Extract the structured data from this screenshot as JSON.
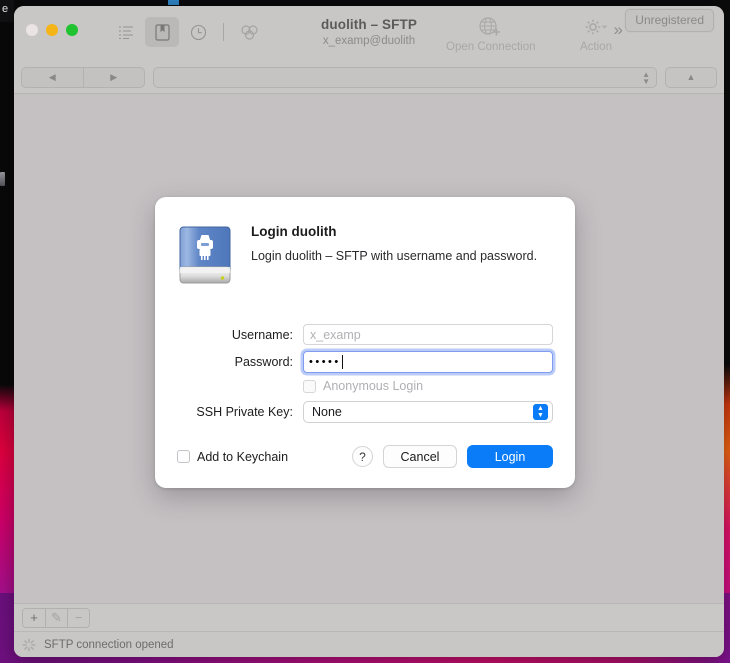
{
  "desktop": {
    "menubar_fragment": "e",
    "wallpaper_colors": [
      "#0a0a0c",
      "#c01030",
      "#ef6a14",
      "#d4106a",
      "#8f1090"
    ]
  },
  "window": {
    "title": "duolith – SFTP",
    "subtitle": "x_examp@duolith",
    "traffic_lights": [
      {
        "name": "close",
        "color": "#ebe4e4"
      },
      {
        "name": "minimize",
        "color": "#f5b518"
      },
      {
        "name": "maximize",
        "color": "#1fc22f"
      }
    ],
    "toolbar": {
      "left_icons": [
        {
          "name": "outline-list-icon",
          "label": "",
          "active": false
        },
        {
          "name": "bookmarks-icon",
          "label": "",
          "active": true
        },
        {
          "name": "history-clock-icon",
          "label": "",
          "active": false
        },
        {
          "name": "bonjour-icon",
          "label": "",
          "active": false
        }
      ],
      "open_connection_label": "Open Connection",
      "action_label": "Action",
      "overflow_glyph": "»",
      "unregistered_label": "Unregistered"
    },
    "navbar": {
      "back_glyph": "◀",
      "forward_glyph": "▶",
      "path_value": "",
      "path_placeholder": "",
      "parent_glyph": "▲"
    },
    "bottom_toolbar": [
      {
        "name": "add-bookmark-button",
        "glyph": "+",
        "enabled": true
      },
      {
        "name": "edit-bookmark-button",
        "glyph": "✎",
        "enabled": false
      },
      {
        "name": "remove-bookmark-button",
        "glyph": "−",
        "enabled": false
      }
    ],
    "status": {
      "text": "SFTP connection opened",
      "spinner_visible": true
    }
  },
  "login_sheet": {
    "icon_name": "network-drive-icon",
    "title": "Login duolith",
    "description": "Login duolith – SFTP with username and password.",
    "fields": {
      "username": {
        "label": "Username:",
        "value": "",
        "placeholder": "x_examp",
        "focused": false
      },
      "password": {
        "label": "Password:",
        "masked_value": "•••••",
        "character_count": 5,
        "focused": true,
        "focus_ring_color": "#7f9cf0"
      },
      "anonymous_login": {
        "label": "Anonymous Login",
        "checked": false,
        "enabled": false
      },
      "ssh_private_key": {
        "label": "SSH Private Key:",
        "selected": "None",
        "options": [
          "None"
        ],
        "accent_color": "#0a7cf7"
      },
      "add_to_keychain": {
        "label": "Add to Keychain",
        "checked": false,
        "enabled": true
      }
    },
    "buttons": {
      "help_label": "?",
      "cancel_label": "Cancel",
      "login_label": "Login",
      "login_color": "#0a7cf7"
    }
  }
}
